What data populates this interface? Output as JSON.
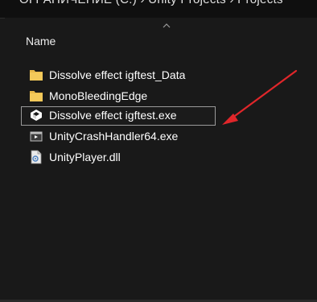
{
  "window": {
    "title_strip_text": "ОГРАНИЧЕНИЕ (C:) › Unity Projects › Projects"
  },
  "columns": {
    "name_label": "Name"
  },
  "files": [
    {
      "name": "Dissolve effect igftest_Data",
      "icon": "folder-icon"
    },
    {
      "name": "MonoBleedingEdge",
      "icon": "folder-icon"
    },
    {
      "name": "Dissolve effect igftest.exe",
      "icon": "unity-app-icon"
    },
    {
      "name": "UnityCrashHandler64.exe",
      "icon": "crash-handler-exe-icon"
    },
    {
      "name": "UnityPlayer.dll",
      "icon": "dll-file-icon"
    }
  ],
  "colors": {
    "background": "#191919",
    "folder": "#e8b94a",
    "annotation_arrow": "#e0262a",
    "selection_border": "#9a9a9a"
  }
}
